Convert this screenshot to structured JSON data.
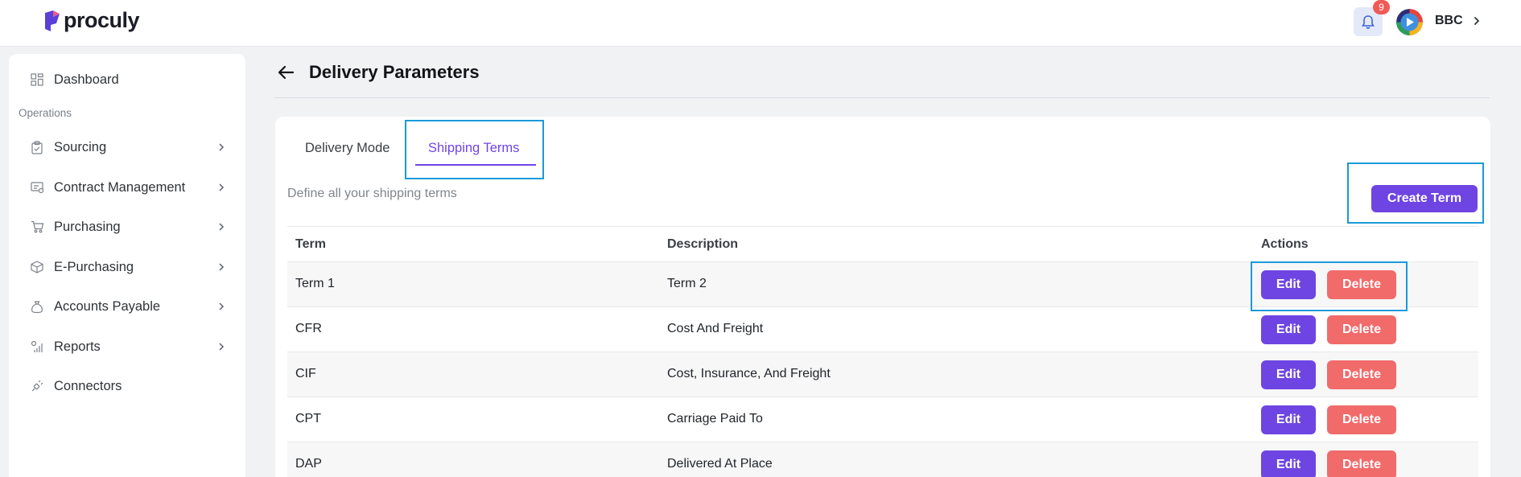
{
  "app": {
    "logo_text": "proculy",
    "notification_count": "9",
    "org_name": "BBC"
  },
  "sidebar": {
    "section_label": "Operations",
    "items": [
      {
        "label": "Dashboard",
        "icon": "dashboard-icon"
      },
      {
        "label": "Sourcing",
        "icon": "clipboard-icon"
      },
      {
        "label": "Contract Management",
        "icon": "contract-icon"
      },
      {
        "label": "Purchasing",
        "icon": "cart-icon"
      },
      {
        "label": "E-Purchasing",
        "icon": "box-icon"
      },
      {
        "label": "Accounts Payable",
        "icon": "money-bag-icon"
      },
      {
        "label": "Reports",
        "icon": "reports-icon"
      },
      {
        "label": "Connectors",
        "icon": "plug-icon"
      }
    ]
  },
  "page": {
    "title": "Delivery Parameters",
    "tabs": [
      {
        "label": "Delivery Mode"
      },
      {
        "label": "Shipping Terms",
        "active": true
      }
    ],
    "subtitle": "Define all your shipping terms",
    "create_label": "Create Term"
  },
  "table": {
    "headers": {
      "term": "Term",
      "description": "Description",
      "actions": "Actions"
    },
    "rows": [
      {
        "term": "Term 1",
        "description": "Term 2"
      },
      {
        "term": "CFR",
        "description": "Cost And Freight"
      },
      {
        "term": "CIF",
        "description": "Cost, Insurance, And Freight"
      },
      {
        "term": "CPT",
        "description": "Carriage Paid To"
      },
      {
        "term": "DAP",
        "description": "Delivered At Place"
      }
    ],
    "edit_label": "Edit",
    "delete_label": "Delete"
  },
  "colors": {
    "accent": "#6e45e2",
    "danger": "#f16b6b",
    "highlight": "#1a9ad8"
  }
}
